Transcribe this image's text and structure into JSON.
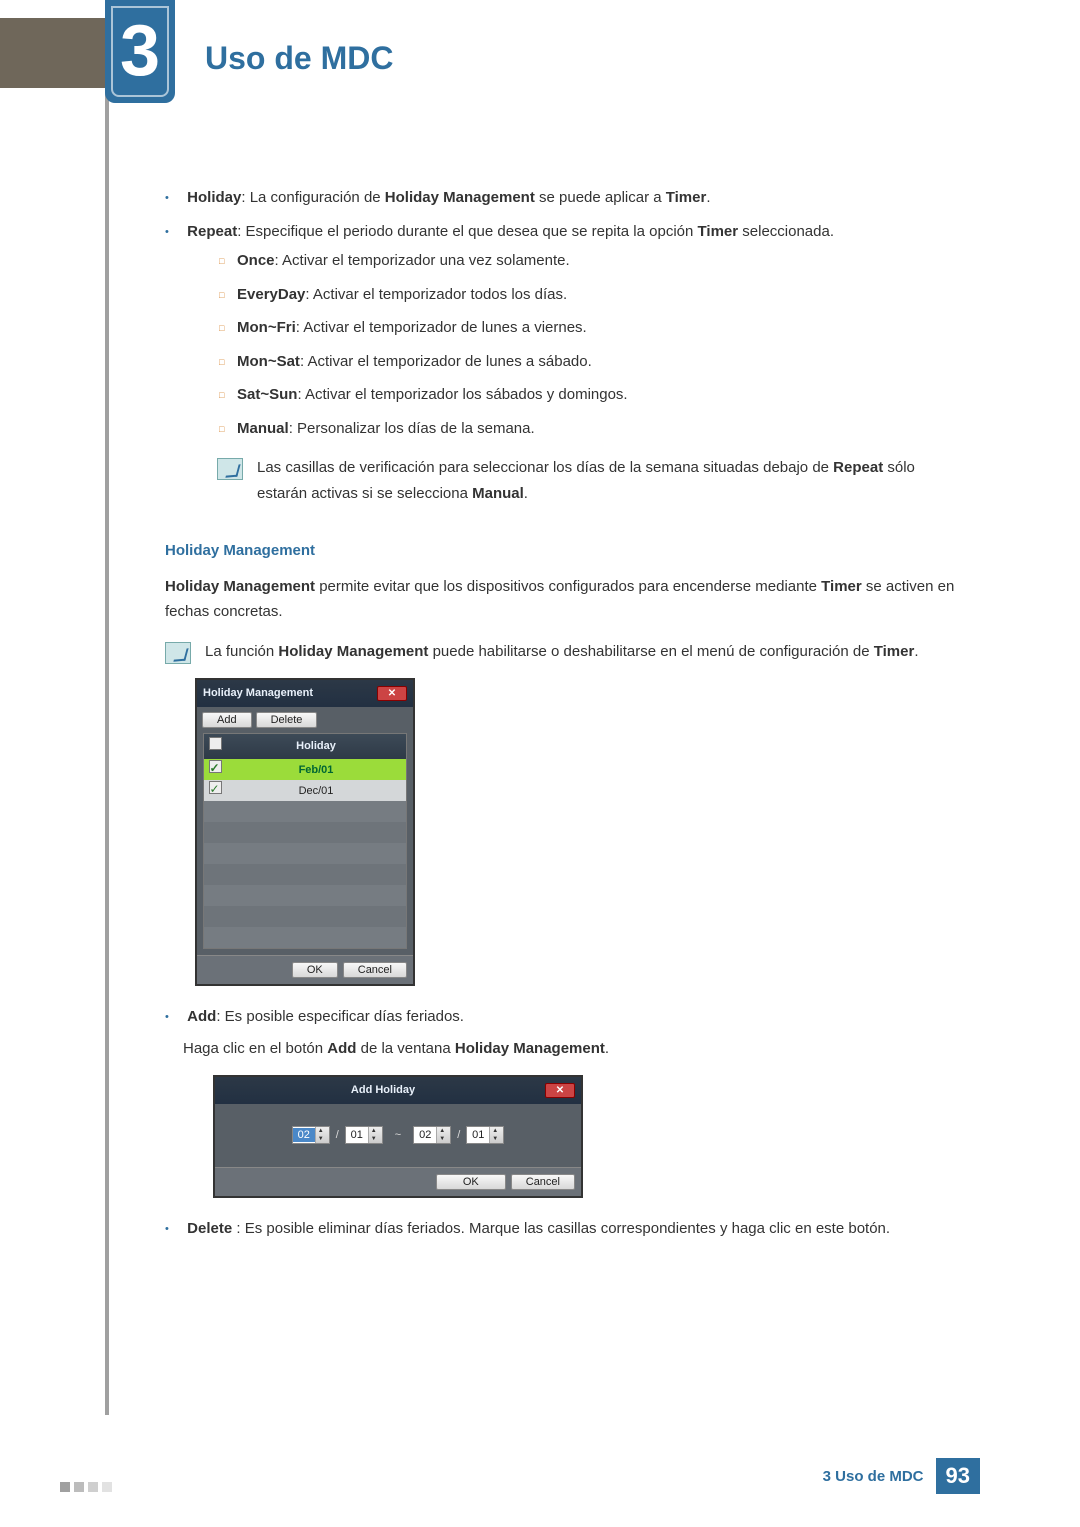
{
  "chapter": {
    "number": "3",
    "title": "Uso de MDC"
  },
  "bullets": {
    "holiday": {
      "term": "Holiday",
      "text": ": La configuración de ",
      "term2": "Holiday Management",
      "text2": " se puede aplicar a ",
      "term3": "Timer",
      "text3": "."
    },
    "repeat_line": "Repeat: Especifique el periodo durante el que desea que se repita la opción Timer seleccionada.",
    "repeat": {
      "term": "Repeat",
      "text": ": Especifique el periodo durante el que desea que se repita la opción ",
      "term2": "Timer",
      "text2": " seleccionada."
    },
    "subs": [
      {
        "term": "Once",
        "text": ": Activar el temporizador una vez solamente."
      },
      {
        "term": "EveryDay",
        "text": ": Activar el temporizador todos los días."
      },
      {
        "term": "Mon~Fri",
        "text": ": Activar el temporizador de lunes a viernes."
      },
      {
        "term": "Mon~Sat",
        "text": ": Activar el temporizador de lunes a sábado."
      },
      {
        "term": "Sat~Sun",
        "text": ": Activar el temporizador los sábados y domingos."
      },
      {
        "term": "Manual",
        "text": ": Personalizar los días de la semana."
      }
    ],
    "note1_a": "Las casillas de verificación para seleccionar los días de la semana situadas debajo de ",
    "note1_b": "Repeat",
    "note1_c": " sólo estarán activas si se selecciona ",
    "note1_d": "Manual",
    "note1_e": "."
  },
  "section": {
    "heading": "Holiday Management",
    "p1_a": "Holiday Management",
    "p1_b": " permite evitar que los dispositivos configurados para encenderse mediante ",
    "p1_c": "Timer",
    "p1_d": " se activen en fechas concretas.",
    "note2_a": "La función ",
    "note2_b": "Holiday Management",
    "note2_c": " puede habilitarse o deshabilitarse en el menú de configuración de ",
    "note2_d": "Timer",
    "note2_e": "."
  },
  "dialog1": {
    "title": "Holiday Management",
    "add": "Add",
    "delete": "Delete",
    "col": "Holiday",
    "rows": [
      "Feb/01",
      "Dec/01"
    ],
    "ok": "OK",
    "cancel": "Cancel"
  },
  "add": {
    "bullet_term": "Add",
    "bullet_text": ": Es posible especificar días feriados.",
    "instr_a": "Haga clic en el botón ",
    "instr_b": "Add",
    "instr_c": " de la ventana ",
    "instr_d": "Holiday Management",
    "instr_e": "."
  },
  "dialog2": {
    "title": "Add Holiday",
    "from_m": "02",
    "from_d": "01",
    "to_m": "02",
    "to_d": "01",
    "sep1": "/",
    "tilde": "~",
    "sep2": "/",
    "ok": "OK",
    "cancel": "Cancel"
  },
  "delete": {
    "term": "Delete ",
    "text": ": Es posible eliminar días feriados. Marque las casillas correspondientes y haga clic en este botón."
  },
  "footer": {
    "text": "3 Uso de MDC",
    "page": "93"
  }
}
